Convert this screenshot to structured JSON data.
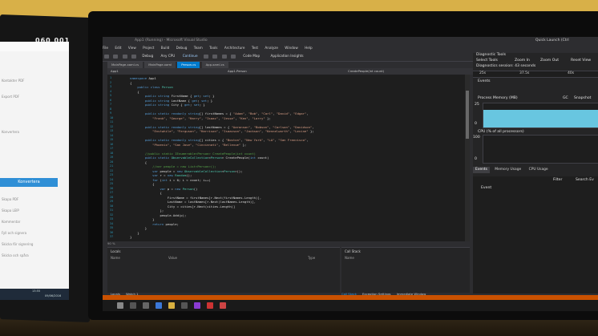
{
  "scene": "photo of a desk with two monitors showing Visual Studio debugging session",
  "left_monitor": {
    "digits": "060 001",
    "items": [
      "Kontakter PDF",
      "Export PDF",
      "Konvertera",
      "Skapa PDF",
      "Skapa LEIP",
      "Kommentar",
      "Fyll och signera",
      "Skicka för signering",
      "Skicka och spåra"
    ],
    "convert_label": "Konvertera",
    "taskbar_time": "13:55",
    "taskbar_date": "09/06/2016"
  },
  "vs": {
    "title": "App1 (Running) - Microsoft Visual Studio",
    "quick_launch": "Quick Launch (Ctrl",
    "menu": [
      "File",
      "Edit",
      "View",
      "Project",
      "Build",
      "Debug",
      "Team",
      "Tools",
      "Architecture",
      "Test",
      "Analyze",
      "Window",
      "Help"
    ],
    "toolbar": {
      "config": "Debug",
      "platform": "Any CPU",
      "continue": "Continue",
      "code_map": "Code Map",
      "app_insights": "Application Insights"
    },
    "tabs": [
      "MainPage.xaml.cs",
      "MainPage.xaml",
      "Person.cs",
      "App.xaml.cs"
    ],
    "active_tab": 2,
    "nav": {
      "project": "App1",
      "class": "App1.Person",
      "member": "CreatePeople(int count)"
    },
    "zoom": "90 %",
    "code": [
      {
        "n": "1",
        "t": "namespace App1"
      },
      {
        "n": "2",
        "t": "{"
      },
      {
        "n": "3",
        "t": "    public class Person"
      },
      {
        "n": "4",
        "t": "    {"
      },
      {
        "n": "5",
        "t": "        public string FirstName { get; set; }"
      },
      {
        "n": "6",
        "t": "        public string LastName { get; set; }"
      },
      {
        "n": "7",
        "t": "        public string City { get; set; }"
      },
      {
        "n": "8",
        "t": ""
      },
      {
        "n": "9",
        "t": "        public static readonly string[] firstNames = { \"Adam\", \"Bob\", \"Carl\", \"David\", \"Edgar\","
      },
      {
        "n": "10",
        "t": "            \"Frank\", \"George\", \"Harry\", \"Isaac\", \"Jesse\", \"Ken\", \"Larry\" };"
      },
      {
        "n": "11",
        "t": ""
      },
      {
        "n": "12",
        "t": "        public static readonly string[] lastNames = { \"Aaronson\", \"Bobson\", \"Carlson\", \"Davidson\","
      },
      {
        "n": "13",
        "t": "            \"Enstwhile\", \"Ferguson\", \"Harrison\", \"Isaacson\", \"Jackson\", \"Kennelworth\", \"Levine\" };"
      },
      {
        "n": "14",
        "t": ""
      },
      {
        "n": "15",
        "t": "        public static readonly string[] cities = { \"Boston\", \"New York\", \"LA\", \"San Francisco\","
      },
      {
        "n": "16",
        "t": "            \"Phoenix\", \"San Jose\", \"Cincinnati\", \"Bellevue\" };"
      },
      {
        "n": "17",
        "t": ""
      },
      {
        "n": "18",
        "t": "        //public static IEnumerable<Person> CreatePeople(int count)"
      },
      {
        "n": "19",
        "t": "        public static ObservableCollection<Person> CreatePeople(int count)"
      },
      {
        "n": "20",
        "t": "        {"
      },
      {
        "n": "21",
        "t": "            //var people = new List<Person>();"
      },
      {
        "n": "22",
        "t": "            var people = new ObservableCollection<Person>();"
      },
      {
        "n": "23",
        "t": "            var r = new Random();"
      },
      {
        "n": "24",
        "t": "            for (int i = 0; i < count; i++)"
      },
      {
        "n": "25",
        "t": "            {"
      },
      {
        "n": "26",
        "t": "                var p = new Person()"
      },
      {
        "n": "27",
        "t": "                {"
      },
      {
        "n": "28",
        "t": "                    FirstName = firstNames[r.Next(firstNames.Length)],"
      },
      {
        "n": "29",
        "t": "                    LastName = lastNames[r.Next(lastNames.Length)],"
      },
      {
        "n": "30",
        "t": "                    City = cities[r.Next(cities.Length)]"
      },
      {
        "n": "31",
        "t": "                };"
      },
      {
        "n": "32",
        "t": "                people.Add(p);"
      },
      {
        "n": "33",
        "t": "            }"
      },
      {
        "n": "34",
        "t": "            return people;"
      },
      {
        "n": "35",
        "t": "        }"
      },
      {
        "n": "36",
        "t": "    }"
      },
      {
        "n": "37",
        "t": "}"
      }
    ],
    "locals": {
      "title": "Locals",
      "col_name": "Name",
      "col_value": "Value",
      "col_type": "Type"
    },
    "callstack": {
      "title": "Call Stack",
      "col_name": "Name"
    },
    "bottom_tabs": [
      "Call Stack",
      "Exception Settings",
      "Immediate Window"
    ],
    "locals_tabs": [
      "Locals",
      "Watch 1"
    ],
    "diagnostics": {
      "title": "Diagnostic Tools",
      "select_tools": "Select Tools",
      "zoom_in": "Zoom In",
      "zoom_out": "Zoom Out",
      "reset_view": "Reset View",
      "session": "Diagnostics session: 43 seconds",
      "ticks": [
        "25s",
        "37.5s",
        "40s"
      ],
      "events_label": "Events",
      "memory_label": "Process Memory (MB)",
      "gc_label": "GC",
      "snapshot_label": "Snapshot",
      "mem_max": "25",
      "mem_min": "0",
      "memory_level": 0.72,
      "cpu_label": "CPU (% of all processors)",
      "cpu_max": "100",
      "cpu_min": "0",
      "tabs": [
        "Events",
        "Memory Usage",
        "CPU Usage"
      ],
      "filter": "Filter",
      "search": "Search Ev",
      "col_event": "Event"
    }
  }
}
